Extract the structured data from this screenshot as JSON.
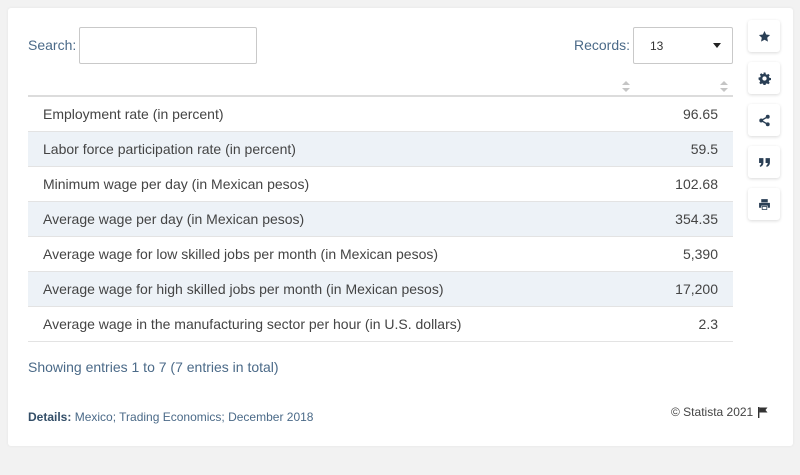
{
  "search": {
    "label": "Search:",
    "value": ""
  },
  "records": {
    "label": "Records:",
    "selected": "13"
  },
  "table": {
    "rows": [
      {
        "label": "Employment rate (in percent)",
        "value": "96.65"
      },
      {
        "label": "Labor force participation rate (in percent)",
        "value": "59.5"
      },
      {
        "label": "Minimum wage per day (in Mexican pesos)",
        "value": "102.68"
      },
      {
        "label": "Average wage per day (in Mexican pesos)",
        "value": "354.35"
      },
      {
        "label": "Average wage for low skilled jobs per month (in Mexican pesos)",
        "value": "5,390"
      },
      {
        "label": "Average wage for high skilled jobs per month (in Mexican pesos)",
        "value": "17,200"
      },
      {
        "label": "Average wage in the manufacturing sector per hour (in U.S. dollars)",
        "value": "2.3"
      }
    ]
  },
  "footer": {
    "showing": "Showing entries 1 to 7 (7 entries in total)",
    "details_label": "Details:",
    "details_text": "Mexico; Trading Economics; December 2018",
    "copyright": "© Statista 2021"
  },
  "sidebar": {
    "icons": [
      "star-icon",
      "gear-icon",
      "share-icon",
      "quote-icon",
      "print-icon"
    ]
  },
  "colors": {
    "accent": "#4b6a88",
    "row_alt": "#edf2f7",
    "icon": "#2a3f55"
  }
}
